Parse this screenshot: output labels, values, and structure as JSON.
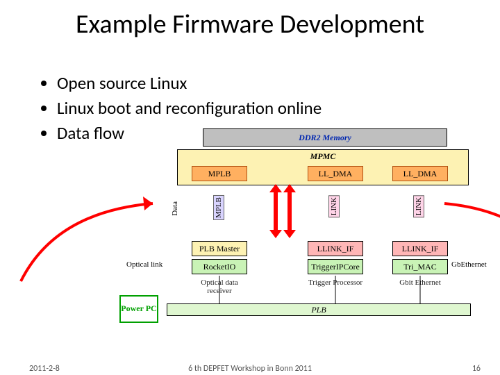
{
  "title": "Example Firmware Development",
  "bullets": {
    "b0": "Open source Linux",
    "b1": "Linux boot and reconfiguration online",
    "b2": "Data flow"
  },
  "diagram": {
    "ddr2": "DDR2 Memory",
    "mpmc": "MPMC",
    "mplb": "MPLB",
    "ll_dma": "LL_DMA",
    "plb_master": "PLB Master",
    "rocketio": "RocketIO",
    "llink_if": "LLINK_IF",
    "trigger_ipcore": "TriggerIPCore",
    "tri_mac": "Tri_MAC",
    "plb": "PLB",
    "power_pc": "Power PC",
    "caption_optical_data_receiver": "Optical data receiver",
    "caption_trigger_processor": "Trigger Processor",
    "caption_gbit_ethernet": "Gbit Ethernet",
    "label_data": "Data",
    "label_mplb_v": "MPLB",
    "label_link": "LINK",
    "label_optical_link": "Optical link",
    "label_gb_ethernet": "GbEthernet"
  },
  "footer": {
    "date": "2011-2-8",
    "center": "6 th DEPFET Workshop in Bonn 2011",
    "page": "16"
  }
}
